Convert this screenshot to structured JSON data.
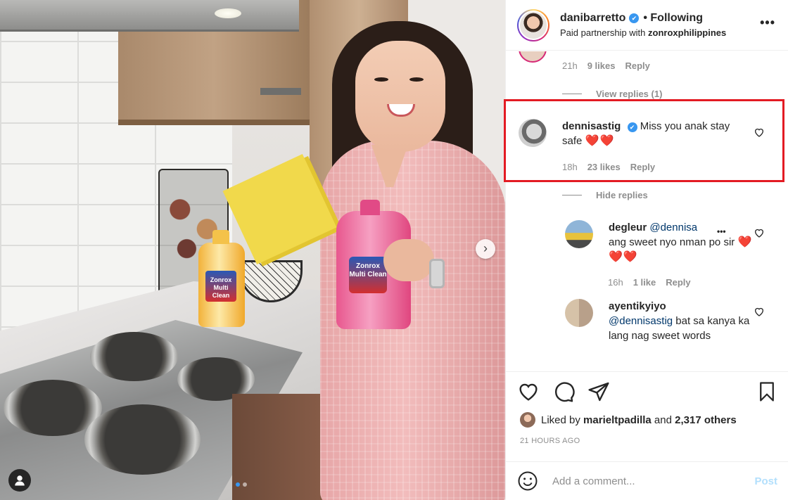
{
  "header": {
    "username": "danibarretto",
    "verified_mark": "✔",
    "follow_status": "• Following",
    "partnership_prefix": "Paid partnership with ",
    "partner": "zonroxphilippines",
    "more_label": "•••"
  },
  "photo": {
    "next_arrow": "›",
    "bottle_brand": "Zonrox Multi Clean"
  },
  "comments": {
    "previous_comment": {
      "time": "21h",
      "likes": "9 likes",
      "reply": "Reply"
    },
    "view_replies": "View replies (1)",
    "highlighted": {
      "username": "dennisastig",
      "verified_mark": "✔",
      "text": " Miss you anak stay safe ",
      "hearts": "❤️❤️",
      "time": "18h",
      "likes": "23 likes",
      "reply": "Reply"
    },
    "hide_replies": "Hide replies",
    "replies": [
      {
        "username": "degleur",
        "mention": "@dennisa",
        "text": "ang sweet nyo nman po sir ",
        "hearts": "❤️❤️❤️",
        "time": "16h",
        "likes": "1 like",
        "reply": "Reply",
        "more": "•••"
      },
      {
        "username": "ayentikyiyo",
        "mention": "@dennisastig",
        "text": " bat sa kanya ka lang nag sweet words"
      }
    ]
  },
  "actions": {
    "liked_by_prefix": "Liked by ",
    "liked_by_user": "marieltpadilla",
    "liked_by_and": " and ",
    "liked_by_others": "2,317 others",
    "time_ago": "21 HOURS AGO"
  },
  "add_comment": {
    "placeholder": "Add a comment...",
    "post_label": "Post"
  },
  "colors": {
    "highlight_border": "#e31b23",
    "verified": "#3897f0",
    "link": "#00376b",
    "muted": "#8e8e8e",
    "post_disabled": "#b2dffc"
  }
}
